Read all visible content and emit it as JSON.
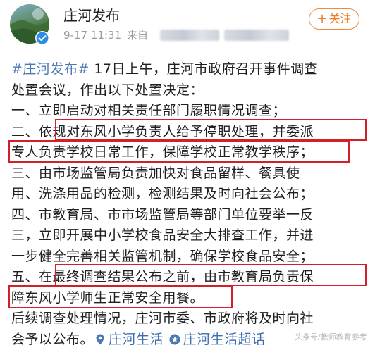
{
  "post": {
    "author": "庄河发布",
    "date": "9-17 11:31",
    "source_prefix": "来自",
    "follow_label": "关注",
    "hashtag": "#庄河发布#",
    "lines": [
      "17日上午，庄河市政府召开事件调查",
      "处置会议，作出以下处置决定：",
      "一、立即启动对相关责任部门履职情况调查；",
      "二、依规对东风小学负责人给予停职处理，并委派",
      "专人负责学校日常工作，保障学校正常教学秩序；",
      "三、由市场监管局负责加快对食品留样、餐具使",
      "用、洗涤用品的检测，检测结果及时向社会公布；",
      "四、市教育局、市市场监管局等部门单位要举一反",
      "三，立即开展中小学校食品安全大排查工作，并进",
      "一步健全完善相关监管机制，确保学校食品安全；",
      "五、在最终调查结果公布之前，由市教育局负责保",
      "障东风小学师生正常安全用餐。",
      "后续调查处理情况，庄河市委、市政府将及时向社",
      "会予以公布。"
    ],
    "location_tag": "庄河生活",
    "topic_tag": "庄河生活超话"
  },
  "watermark": "头条号/教师教育参考",
  "colors": {
    "link": "#4a78b5",
    "highlight_box": "#d21f2a",
    "follow": "#f07a25"
  }
}
